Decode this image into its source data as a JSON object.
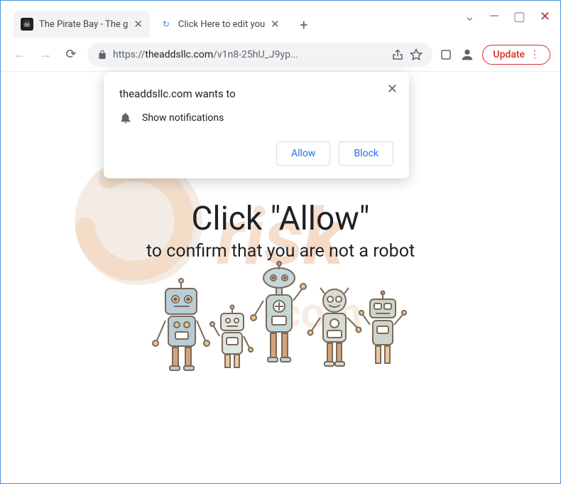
{
  "window": {
    "controls": {
      "chevron": "⌄",
      "min": "—",
      "max": "▢",
      "close": "✕"
    }
  },
  "tabs": [
    {
      "title": "The Pirate Bay - The g",
      "active": false
    },
    {
      "title": "Click Here to edit you",
      "active": true
    }
  ],
  "toolbar": {
    "url_scheme": "https://",
    "url_host": "theaddsllc.com",
    "url_path": "/v1n8-25hU_J9yp...",
    "update_label": "Update"
  },
  "permission": {
    "title": "theaddsllc.com wants to",
    "item": "Show notifications",
    "allow": "Allow",
    "block": "Block"
  },
  "page": {
    "heading": "Click \"Allow\"",
    "subheading": "to confirm that you are not a robot"
  },
  "watermark": "pcrisk.com"
}
